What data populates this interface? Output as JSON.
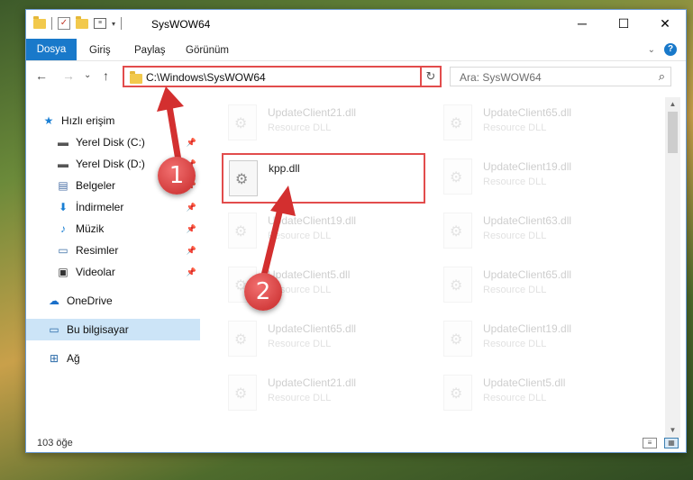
{
  "window": {
    "title": "SysWOW64",
    "controls": {
      "minimize": "─",
      "maximize": "☐",
      "close": "✕"
    }
  },
  "ribbon": {
    "tabs": [
      {
        "label": "Dosya"
      },
      {
        "label": "Giriş"
      },
      {
        "label": "Paylaş"
      },
      {
        "label": "Görünüm"
      }
    ]
  },
  "nav": {
    "back": "←",
    "forward": "→",
    "recent": "⌄",
    "up": "↑",
    "address": "C:\\Windows\\SysWOW64",
    "search_placeholder": "Ara: SysWOW64"
  },
  "sidebar": {
    "items": [
      {
        "label": "Hızlı erişim",
        "icon": "star-icon",
        "glyph": "★",
        "color": "#1a7fd4"
      },
      {
        "label": "Yerel Disk (C:)",
        "icon": "drive-icon",
        "glyph": "▬",
        "color": "#555555",
        "pinned": true
      },
      {
        "label": "Yerel Disk (D:)",
        "icon": "drive-icon",
        "glyph": "▬",
        "color": "#555555",
        "pinned": true
      },
      {
        "label": "Belgeler",
        "icon": "documents-icon",
        "glyph": "▤",
        "color": "#4a6fa5",
        "pinned": true
      },
      {
        "label": "İndirmeler",
        "icon": "downloads-icon",
        "glyph": "⬇",
        "color": "#1a7fd4",
        "pinned": true
      },
      {
        "label": "Müzik",
        "icon": "music-icon",
        "glyph": "♪",
        "color": "#1a7fd4",
        "pinned": true
      },
      {
        "label": "Resimler",
        "icon": "pictures-icon",
        "glyph": "▭",
        "color": "#3a6ea5",
        "pinned": true
      },
      {
        "label": "Videolar",
        "icon": "videos-icon",
        "glyph": "▣",
        "color": "#333333",
        "pinned": true
      },
      {
        "label": "OneDrive",
        "icon": "cloud-icon",
        "glyph": "☁",
        "color": "#1a6fc9"
      },
      {
        "label": "Bu bilgisayar",
        "icon": "computer-icon",
        "glyph": "▭",
        "color": "#2a6aa8",
        "selected": true
      },
      {
        "label": "Ağ",
        "icon": "network-icon",
        "glyph": "⊞",
        "color": "#2a6aa8"
      }
    ]
  },
  "files": [
    {
      "name": "UpdateClient21.dll",
      "type": "Resource DLL",
      "faded": true
    },
    {
      "name": "UpdateClient65.dll",
      "type": "Resource DLL",
      "faded": true
    },
    {
      "name": "kpp.dll",
      "type": "",
      "faded": false,
      "highlighted": true
    },
    {
      "name": "UpdateClient19.dll",
      "type": "Resource DLL",
      "faded": true
    },
    {
      "name": "UpdateClient19.dll",
      "type": "Resource DLL",
      "faded": true
    },
    {
      "name": "UpdateClient63.dll",
      "type": "Resource DLL",
      "faded": true
    },
    {
      "name": "UpdateClient5.dll",
      "type": "Resource DLL",
      "faded": true
    },
    {
      "name": "UpdateClient65.dll",
      "type": "Resource DLL",
      "faded": true
    },
    {
      "name": "UpdateClient65.dll",
      "type": "Resource DLL",
      "faded": true
    },
    {
      "name": "UpdateClient19.dll",
      "type": "Resource DLL",
      "faded": true
    },
    {
      "name": "UpdateClient21.dll",
      "type": "Resource DLL",
      "faded": true
    },
    {
      "name": "UpdateClient5.dll",
      "type": "Resource DLL",
      "faded": true
    }
  ],
  "status": {
    "count": "103 öğe"
  },
  "annotations": [
    {
      "label": "1"
    },
    {
      "label": "2"
    }
  ],
  "colors": {
    "accent": "#1979ca",
    "highlight": "#e24c4c",
    "badge": "#d32f2f"
  }
}
